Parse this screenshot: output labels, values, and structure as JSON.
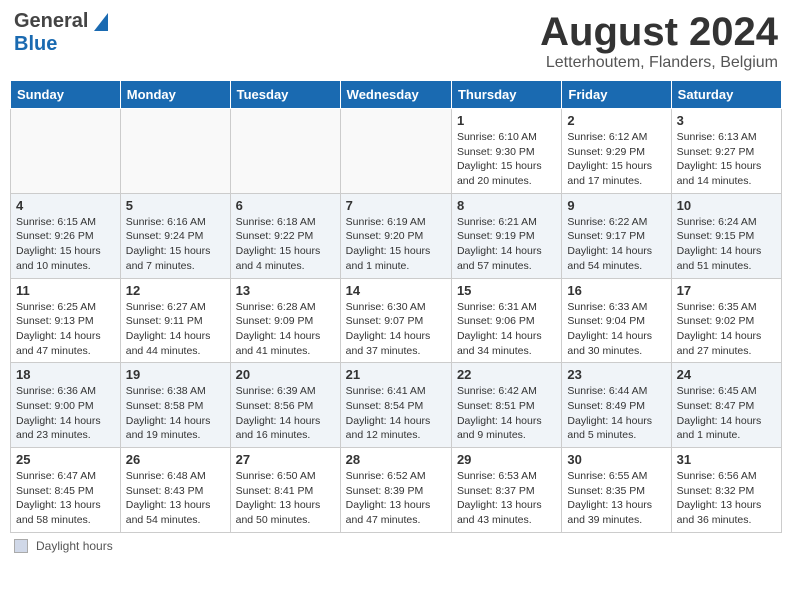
{
  "header": {
    "logo_general": "General",
    "logo_blue": "Blue",
    "title": "August 2024",
    "subtitle": "Letterhoutem, Flanders, Belgium"
  },
  "weekdays": [
    "Sunday",
    "Monday",
    "Tuesday",
    "Wednesday",
    "Thursday",
    "Friday",
    "Saturday"
  ],
  "footer": {
    "daylight_label": "Daylight hours"
  },
  "weeks": [
    [
      {
        "day": "",
        "info": ""
      },
      {
        "day": "",
        "info": ""
      },
      {
        "day": "",
        "info": ""
      },
      {
        "day": "",
        "info": ""
      },
      {
        "day": "1",
        "info": "Sunrise: 6:10 AM\nSunset: 9:30 PM\nDaylight: 15 hours\nand 20 minutes."
      },
      {
        "day": "2",
        "info": "Sunrise: 6:12 AM\nSunset: 9:29 PM\nDaylight: 15 hours\nand 17 minutes."
      },
      {
        "day": "3",
        "info": "Sunrise: 6:13 AM\nSunset: 9:27 PM\nDaylight: 15 hours\nand 14 minutes."
      }
    ],
    [
      {
        "day": "4",
        "info": "Sunrise: 6:15 AM\nSunset: 9:26 PM\nDaylight: 15 hours\nand 10 minutes."
      },
      {
        "day": "5",
        "info": "Sunrise: 6:16 AM\nSunset: 9:24 PM\nDaylight: 15 hours\nand 7 minutes."
      },
      {
        "day": "6",
        "info": "Sunrise: 6:18 AM\nSunset: 9:22 PM\nDaylight: 15 hours\nand 4 minutes."
      },
      {
        "day": "7",
        "info": "Sunrise: 6:19 AM\nSunset: 9:20 PM\nDaylight: 15 hours\nand 1 minute."
      },
      {
        "day": "8",
        "info": "Sunrise: 6:21 AM\nSunset: 9:19 PM\nDaylight: 14 hours\nand 57 minutes."
      },
      {
        "day": "9",
        "info": "Sunrise: 6:22 AM\nSunset: 9:17 PM\nDaylight: 14 hours\nand 54 minutes."
      },
      {
        "day": "10",
        "info": "Sunrise: 6:24 AM\nSunset: 9:15 PM\nDaylight: 14 hours\nand 51 minutes."
      }
    ],
    [
      {
        "day": "11",
        "info": "Sunrise: 6:25 AM\nSunset: 9:13 PM\nDaylight: 14 hours\nand 47 minutes."
      },
      {
        "day": "12",
        "info": "Sunrise: 6:27 AM\nSunset: 9:11 PM\nDaylight: 14 hours\nand 44 minutes."
      },
      {
        "day": "13",
        "info": "Sunrise: 6:28 AM\nSunset: 9:09 PM\nDaylight: 14 hours\nand 41 minutes."
      },
      {
        "day": "14",
        "info": "Sunrise: 6:30 AM\nSunset: 9:07 PM\nDaylight: 14 hours\nand 37 minutes."
      },
      {
        "day": "15",
        "info": "Sunrise: 6:31 AM\nSunset: 9:06 PM\nDaylight: 14 hours\nand 34 minutes."
      },
      {
        "day": "16",
        "info": "Sunrise: 6:33 AM\nSunset: 9:04 PM\nDaylight: 14 hours\nand 30 minutes."
      },
      {
        "day": "17",
        "info": "Sunrise: 6:35 AM\nSunset: 9:02 PM\nDaylight: 14 hours\nand 27 minutes."
      }
    ],
    [
      {
        "day": "18",
        "info": "Sunrise: 6:36 AM\nSunset: 9:00 PM\nDaylight: 14 hours\nand 23 minutes."
      },
      {
        "day": "19",
        "info": "Sunrise: 6:38 AM\nSunset: 8:58 PM\nDaylight: 14 hours\nand 19 minutes."
      },
      {
        "day": "20",
        "info": "Sunrise: 6:39 AM\nSunset: 8:56 PM\nDaylight: 14 hours\nand 16 minutes."
      },
      {
        "day": "21",
        "info": "Sunrise: 6:41 AM\nSunset: 8:54 PM\nDaylight: 14 hours\nand 12 minutes."
      },
      {
        "day": "22",
        "info": "Sunrise: 6:42 AM\nSunset: 8:51 PM\nDaylight: 14 hours\nand 9 minutes."
      },
      {
        "day": "23",
        "info": "Sunrise: 6:44 AM\nSunset: 8:49 PM\nDaylight: 14 hours\nand 5 minutes."
      },
      {
        "day": "24",
        "info": "Sunrise: 6:45 AM\nSunset: 8:47 PM\nDaylight: 14 hours\nand 1 minute."
      }
    ],
    [
      {
        "day": "25",
        "info": "Sunrise: 6:47 AM\nSunset: 8:45 PM\nDaylight: 13 hours\nand 58 minutes."
      },
      {
        "day": "26",
        "info": "Sunrise: 6:48 AM\nSunset: 8:43 PM\nDaylight: 13 hours\nand 54 minutes."
      },
      {
        "day": "27",
        "info": "Sunrise: 6:50 AM\nSunset: 8:41 PM\nDaylight: 13 hours\nand 50 minutes."
      },
      {
        "day": "28",
        "info": "Sunrise: 6:52 AM\nSunset: 8:39 PM\nDaylight: 13 hours\nand 47 minutes."
      },
      {
        "day": "29",
        "info": "Sunrise: 6:53 AM\nSunset: 8:37 PM\nDaylight: 13 hours\nand 43 minutes."
      },
      {
        "day": "30",
        "info": "Sunrise: 6:55 AM\nSunset: 8:35 PM\nDaylight: 13 hours\nand 39 minutes."
      },
      {
        "day": "31",
        "info": "Sunrise: 6:56 AM\nSunset: 8:32 PM\nDaylight: 13 hours\nand 36 minutes."
      }
    ]
  ]
}
